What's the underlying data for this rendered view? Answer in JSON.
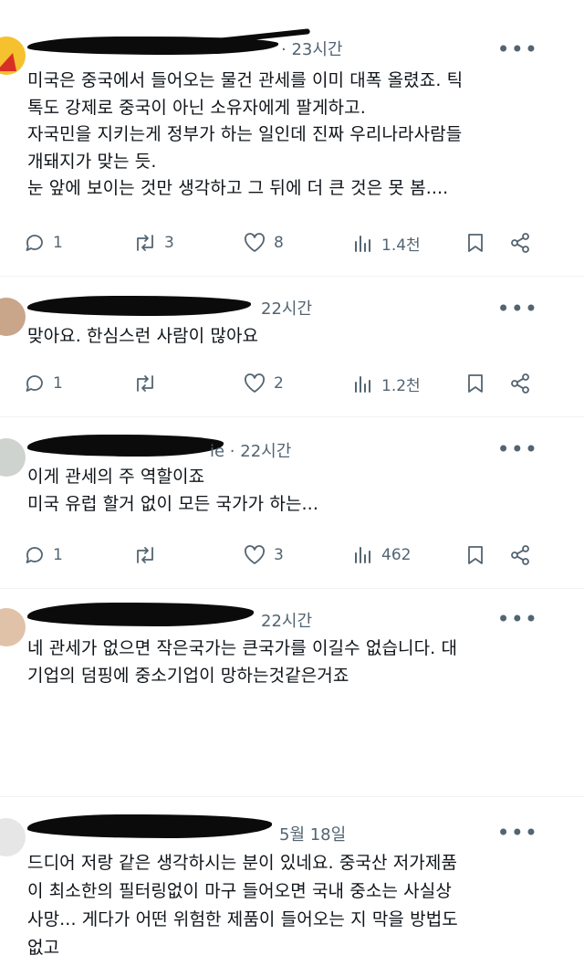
{
  "posts": [
    {
      "time": "· 23시간",
      "lines": [
        "미국은 중국에서 들어오는 물건 관세를 이미 대폭 올렸죠. 틱",
        "톡도 강제로 중국이 아닌 소유자에게 팔게하고.",
        "자국민을 지키는게 정부가 하는 일인데 진짜 우리나라사람들",
        "개돼지가 맞는 듯.",
        "눈 앞에 보이는 것만 생각하고 그 뒤에 더 큰 것은 못 봄...."
      ],
      "replies": "1",
      "reposts": "3",
      "likes": "8",
      "views": "1.4천"
    },
    {
      "time": "22시간",
      "lines": [
        "맞아요. 한심스런 사람이 많아요"
      ],
      "replies": "1",
      "reposts": "",
      "likes": "2",
      "views": "1.2천"
    },
    {
      "time": "ie · 22시간",
      "lines": [
        "이게 관세의 주 역할이죠",
        "미국 유럽 할거 없이 모든 국가가 하는..."
      ],
      "replies": "1",
      "reposts": "",
      "likes": "3",
      "views": "462"
    },
    {
      "time": "22시간",
      "lines": [
        "네 관세가 없으면  작은국가는 큰국가를 이길수 없습니다. 대",
        "기업의 덤핑에 중소기업이 망하는것같은거죠"
      ]
    },
    {
      "time": "5월 18일",
      "lines": [
        "드디어 저랑 같은 생각하시는 분이 있네요. 중국산 저가제품",
        "이 최소한의 필터링없이 마구 들어오면 국내 중소는 사실상",
        "사망... 게다가 어떤 위험한 제품이 들어오는 지 막을 방법도",
        "없고"
      ]
    }
  ],
  "more_label": "•••"
}
